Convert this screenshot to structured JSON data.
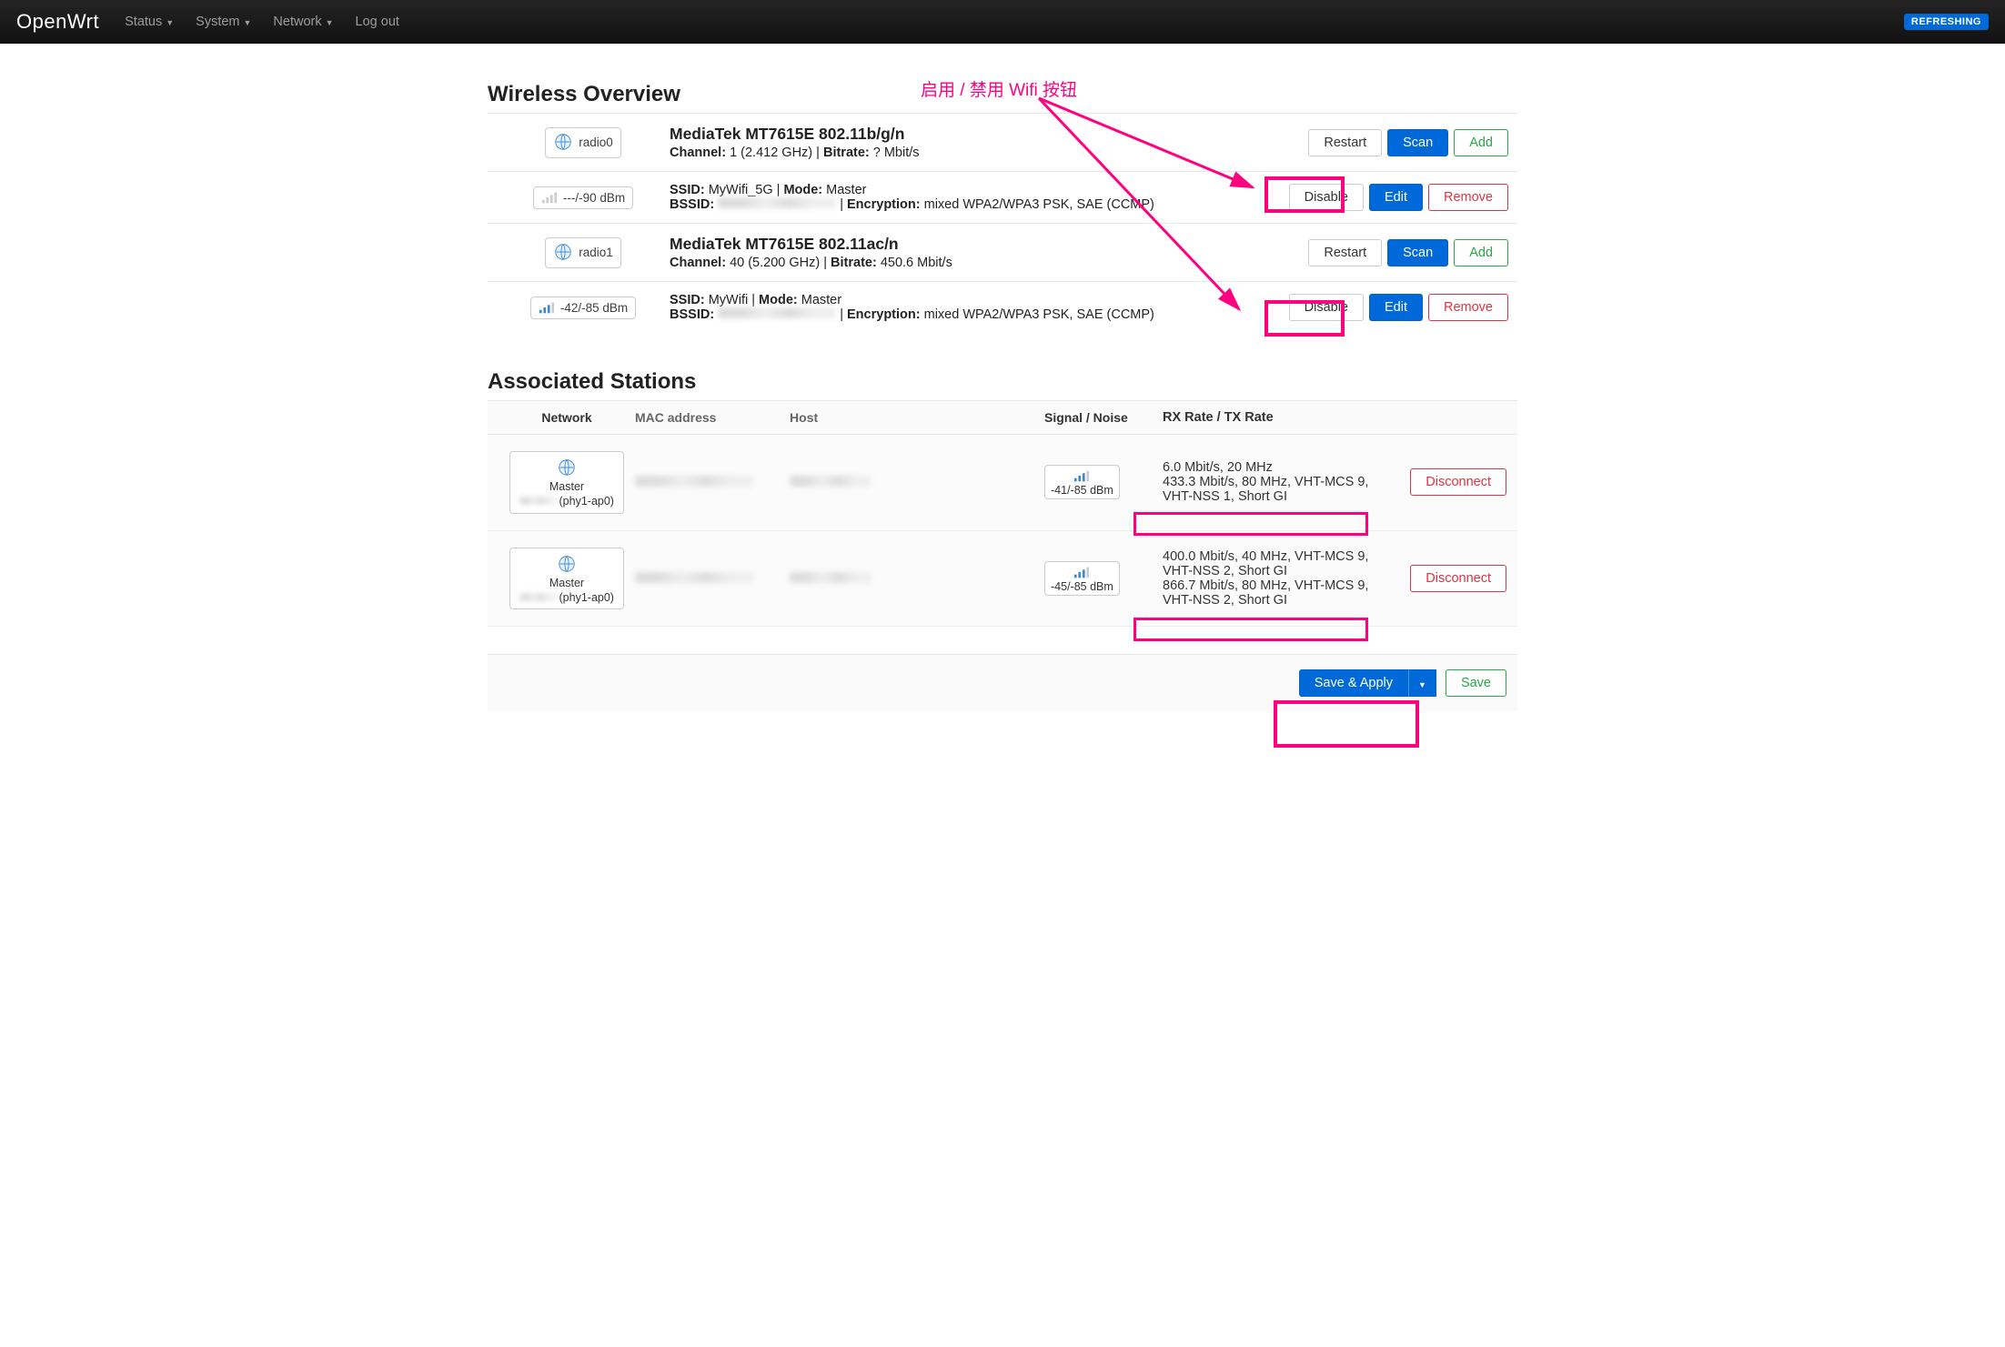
{
  "nav": {
    "brand": "OpenWrt",
    "items": [
      "Status",
      "System",
      "Network",
      "Log out"
    ],
    "refresh": "REFRESHING"
  },
  "section_wireless": "Wireless Overview",
  "section_stations": "Associated Stations",
  "annotation_text": "启用 / 禁用 Wifi 按钮",
  "radios": [
    {
      "name": "radio0",
      "title": "MediaTek MT7615E 802.11b/g/n",
      "channel_label": "Channel:",
      "channel_val": "1 (2.412 GHz)",
      "bitrate_label": "Bitrate:",
      "bitrate_val": "? Mbit/s",
      "btn_restart": "Restart",
      "btn_scan": "Scan",
      "btn_add": "Add",
      "net": {
        "signal": "---/-90 dBm",
        "ssid_label": "SSID:",
        "ssid": "MyWifi_5G",
        "mode_label": "Mode:",
        "mode": "Master",
        "bssid_label": "BSSID:",
        "bssid": "",
        "enc_label": "Encryption:",
        "enc": "mixed WPA2/WPA3 PSK, SAE (CCMP)",
        "btn_disable": "Disable",
        "btn_edit": "Edit",
        "btn_remove": "Remove"
      }
    },
    {
      "name": "radio1",
      "title": "MediaTek MT7615E 802.11ac/n",
      "channel_label": "Channel:",
      "channel_val": "40 (5.200 GHz)",
      "bitrate_label": "Bitrate:",
      "bitrate_val": "450.6 Mbit/s",
      "btn_restart": "Restart",
      "btn_scan": "Scan",
      "btn_add": "Add",
      "net": {
        "signal": "-42/-85 dBm",
        "ssid_label": "SSID:",
        "ssid": "MyWifi",
        "mode_label": "Mode:",
        "mode": "Master",
        "bssid_label": "BSSID:",
        "bssid": "",
        "enc_label": "Encryption:",
        "enc": "mixed WPA2/WPA3 PSK, SAE (CCMP)",
        "btn_disable": "Disable",
        "btn_edit": "Edit",
        "btn_remove": "Remove"
      }
    }
  ],
  "stations_header": {
    "network": "Network",
    "mac": "MAC address",
    "host": "Host",
    "signal": "Signal / Noise",
    "rate": "RX Rate / TX Rate"
  },
  "stations": [
    {
      "net_role": "Master",
      "net_iface": "(phy1-ap0)",
      "signal": "-41/-85 dBm",
      "rx": "6.0 Mbit/s, 20 MHz",
      "tx": "433.3 Mbit/s, 80 MHz, VHT-MCS 9, VHT-NSS 1, Short GI",
      "disconnect": "Disconnect"
    },
    {
      "net_role": "Master",
      "net_iface": "(phy1-ap0)",
      "signal": "-45/-85 dBm",
      "rx": "400.0 Mbit/s, 40 MHz, VHT-MCS 9, VHT-NSS 2, Short GI",
      "tx": "866.7 Mbit/s, 80 MHz, VHT-MCS 9, VHT-NSS 2, Short GI",
      "disconnect": "Disconnect"
    }
  ],
  "footer": {
    "save_apply": "Save & Apply",
    "save": "Save"
  }
}
